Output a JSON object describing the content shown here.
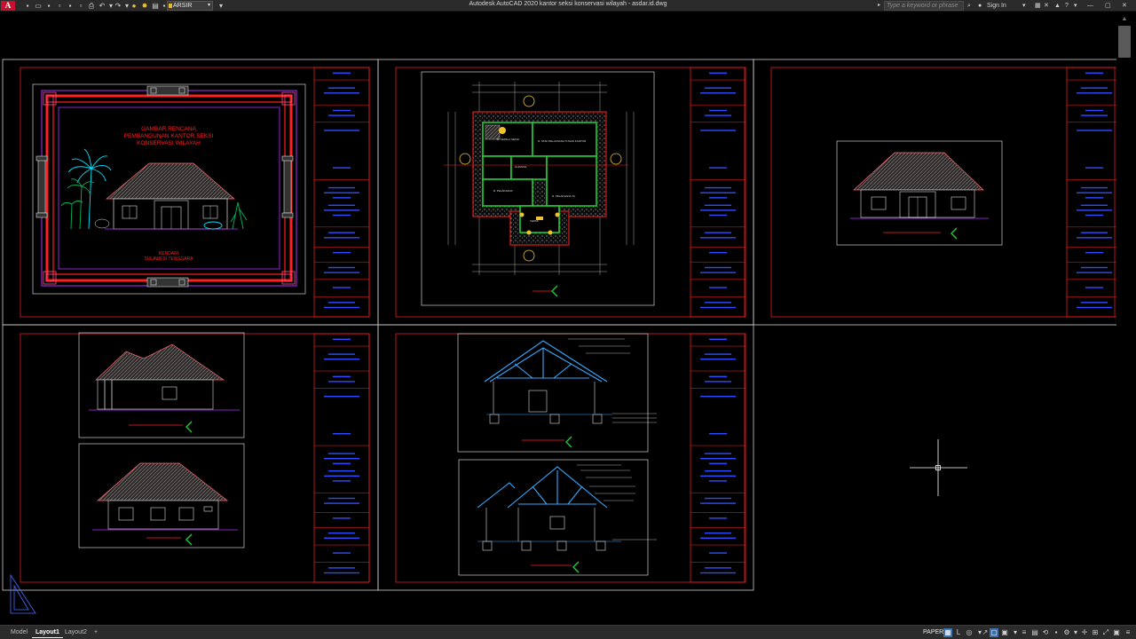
{
  "app": {
    "logo_letter": "A",
    "window_title": "Autodesk AutoCAD 2020   kantor seksi konservasi wilayah - asdar.id.dwg",
    "workspace": "ARSIR",
    "search_placeholder": "Type a keyword or phrase",
    "sign_in": "Sign In"
  },
  "sheet1": {
    "title_lines": [
      "GAMBAR RENCANA",
      "PEMBANGUNAN KANTOR SEKSI",
      "KONSERVASI WILAYAH"
    ],
    "location_lines": [
      "KENDARI",
      "SULAWESI TENGGARA"
    ]
  },
  "floor_plan_labels": [
    "R. KEPALA SEKSI",
    "R. STAF PELAKSANA TUGAS KANTOR",
    "GUDANG",
    "TEPAS",
    "R. PELAKSANA",
    "R. PELAKSANA TU"
  ],
  "layout_tabs": [
    "Model",
    "Layout1",
    "Layout2"
  ],
  "active_tab": "Layout1",
  "status": {
    "mode": "PAPER"
  },
  "colors": {
    "sheet_border": "#cfcfcf",
    "frame_red": "#ff2020",
    "title_block_blue": "#2e4cff",
    "frame_magenta": "#b030ff",
    "tree_cyan": "#00e5ff",
    "section_blue": "#38a8ff",
    "room_green": "#22cc33"
  }
}
